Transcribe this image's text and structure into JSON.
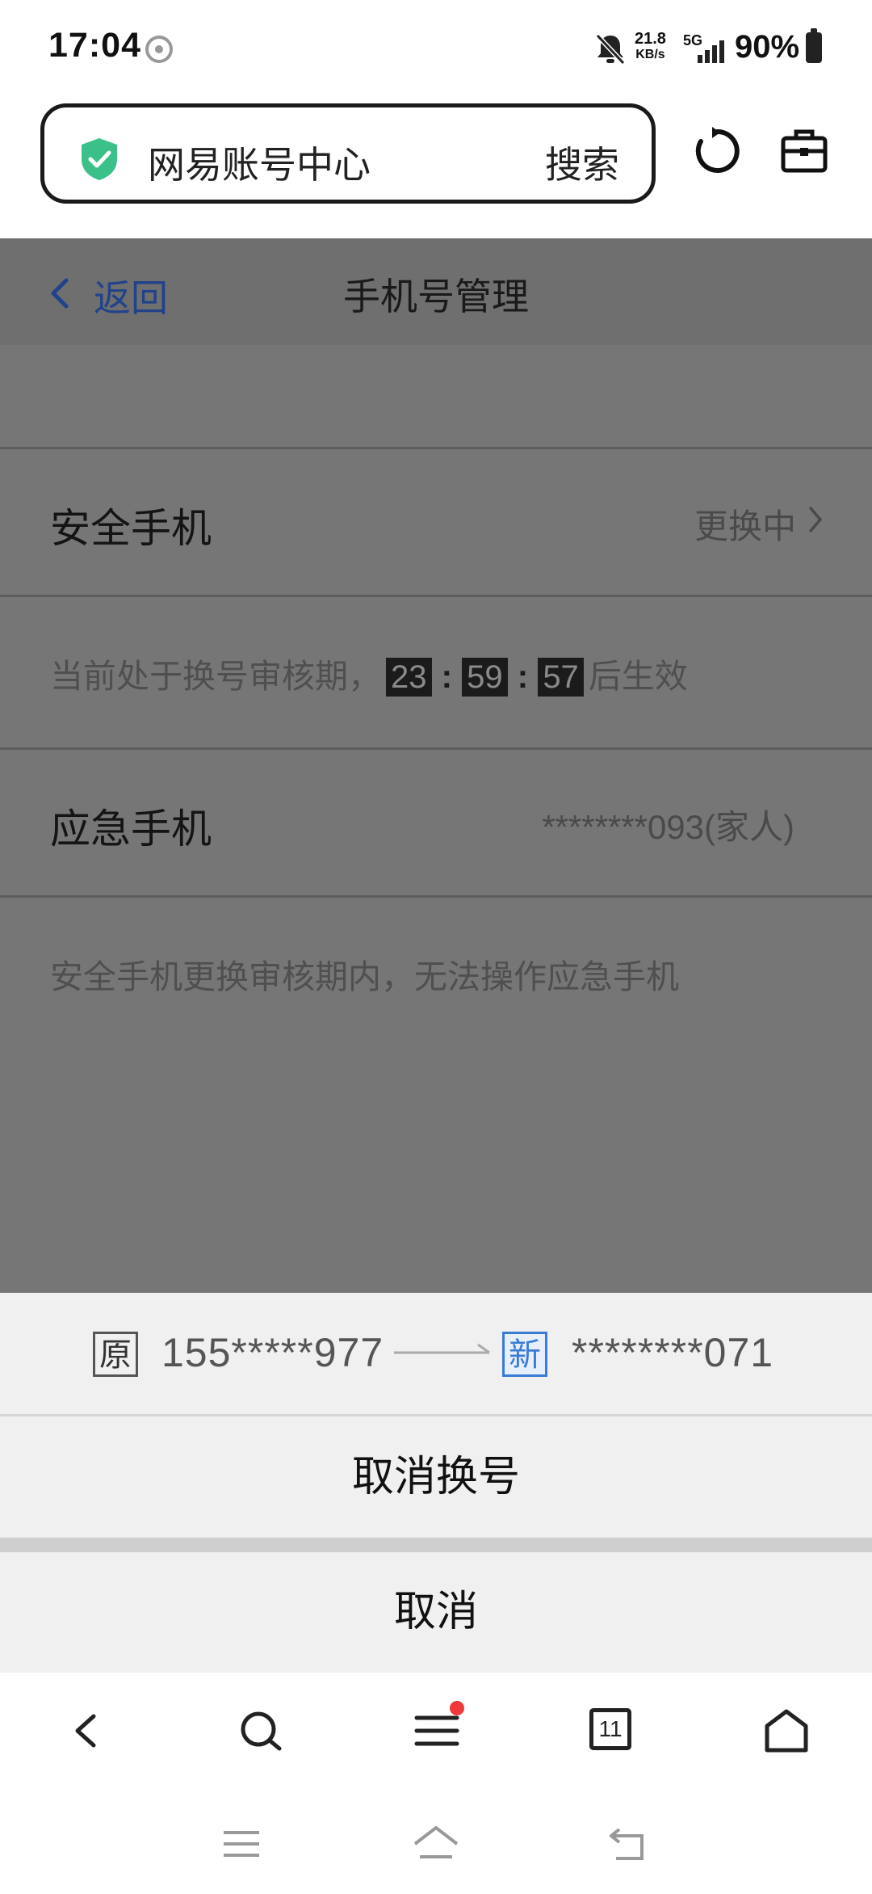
{
  "status_bar": {
    "time": "17:04",
    "net_speed_value": "21.8",
    "net_speed_unit": "KB/s",
    "network_type": "5G",
    "battery": "90%"
  },
  "browser": {
    "url_title": "网易账号中心",
    "search_label": "搜索"
  },
  "page": {
    "back_label": "返回",
    "title": "手机号管理",
    "security_phone": {
      "label": "安全手机",
      "status": "更换中"
    },
    "review_hint": {
      "prefix": "当前处于换号审核期，",
      "hours": "23",
      "minutes": "59",
      "seconds": "57",
      "colon": ":",
      "suffix": "后生效"
    },
    "emergency_phone": {
      "label": "应急手机",
      "value": "********093(家人)"
    },
    "emergency_hint": "安全手机更换审核期内，无法操作应急手机"
  },
  "sheet": {
    "old_tag": "原",
    "old_number": "155*****977",
    "new_tag": "新",
    "new_number": "********071",
    "cancel_change_label": "取消换号",
    "cancel_label": "取消"
  },
  "bottom_nav": {
    "tabs_count": "11"
  },
  "colors": {
    "shield_green": "#3cc08a",
    "accent_blue": "#3a7bd5",
    "badge_red": "#f03a3a"
  }
}
